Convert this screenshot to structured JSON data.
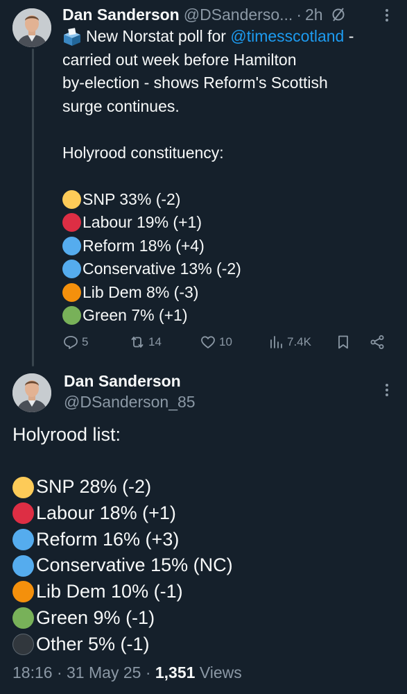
{
  "tweet1": {
    "author_name": "Dan Sanderson",
    "author_handle": "@DSanderso...",
    "separator": "·",
    "time": "2h",
    "text_lines": {
      "l1_pre": "New Norstat poll for",
      "l1_mention": "@timesscotland",
      "l1_post": "-",
      "l2": "carried out week before Hamilton",
      "l3": "by-election - shows Reform's Scottish",
      "l4": "surge continues.",
      "l6": "Holyrood constituency:"
    },
    "results": [
      {
        "emoji": "yellow-circle",
        "text": "SNP 33% (-2)"
      },
      {
        "emoji": "red-circle",
        "text": "Labour 19% (+1)"
      },
      {
        "emoji": "blue-circle",
        "text": "Reform 18% (+4)"
      },
      {
        "emoji": "blue-circle",
        "text": "Conservative 13% (-2)"
      },
      {
        "emoji": "orange-circle",
        "text": "Lib Dem 8% (-3)"
      },
      {
        "emoji": "green-circle",
        "text": "Green 7% (+1)"
      }
    ],
    "actions": {
      "replies": "5",
      "reposts": "14",
      "likes": "10",
      "views": "7.4K"
    }
  },
  "tweet2": {
    "author_name": "Dan Sanderson",
    "author_handle": "@DSanderson_85",
    "heading": "Holyrood list:",
    "results": [
      {
        "emoji": "yellow-circle",
        "text": "SNP 28% (-2)"
      },
      {
        "emoji": "red-circle",
        "text": "Labour 18% (+1)"
      },
      {
        "emoji": "blue-circle",
        "text": "Reform 16% (+3)"
      },
      {
        "emoji": "blue-circle",
        "text": "Conservative 15% (NC)"
      },
      {
        "emoji": "orange-circle",
        "text": "Lib Dem 10% (-1)"
      },
      {
        "emoji": "green-circle",
        "text": "Green 9% (-1)"
      },
      {
        "emoji": "black-circle",
        "text": "Other 5% (-1)"
      }
    ],
    "meta": {
      "time": "18:16",
      "separator1": "·",
      "date": "31 May 25",
      "separator2": "·",
      "views_count": "1,351",
      "views_label": "Views"
    }
  },
  "colors": {
    "background": "#15202b",
    "text": "#f7f9f9",
    "secondary": "#8b98a5",
    "link": "#1d9bf0",
    "yellow-circle": "#fdcb58",
    "red-circle": "#dd2e44",
    "blue-circle": "#55acee",
    "orange-circle": "#f4900c",
    "green-circle": "#78b159",
    "black-circle": "#31373d"
  }
}
